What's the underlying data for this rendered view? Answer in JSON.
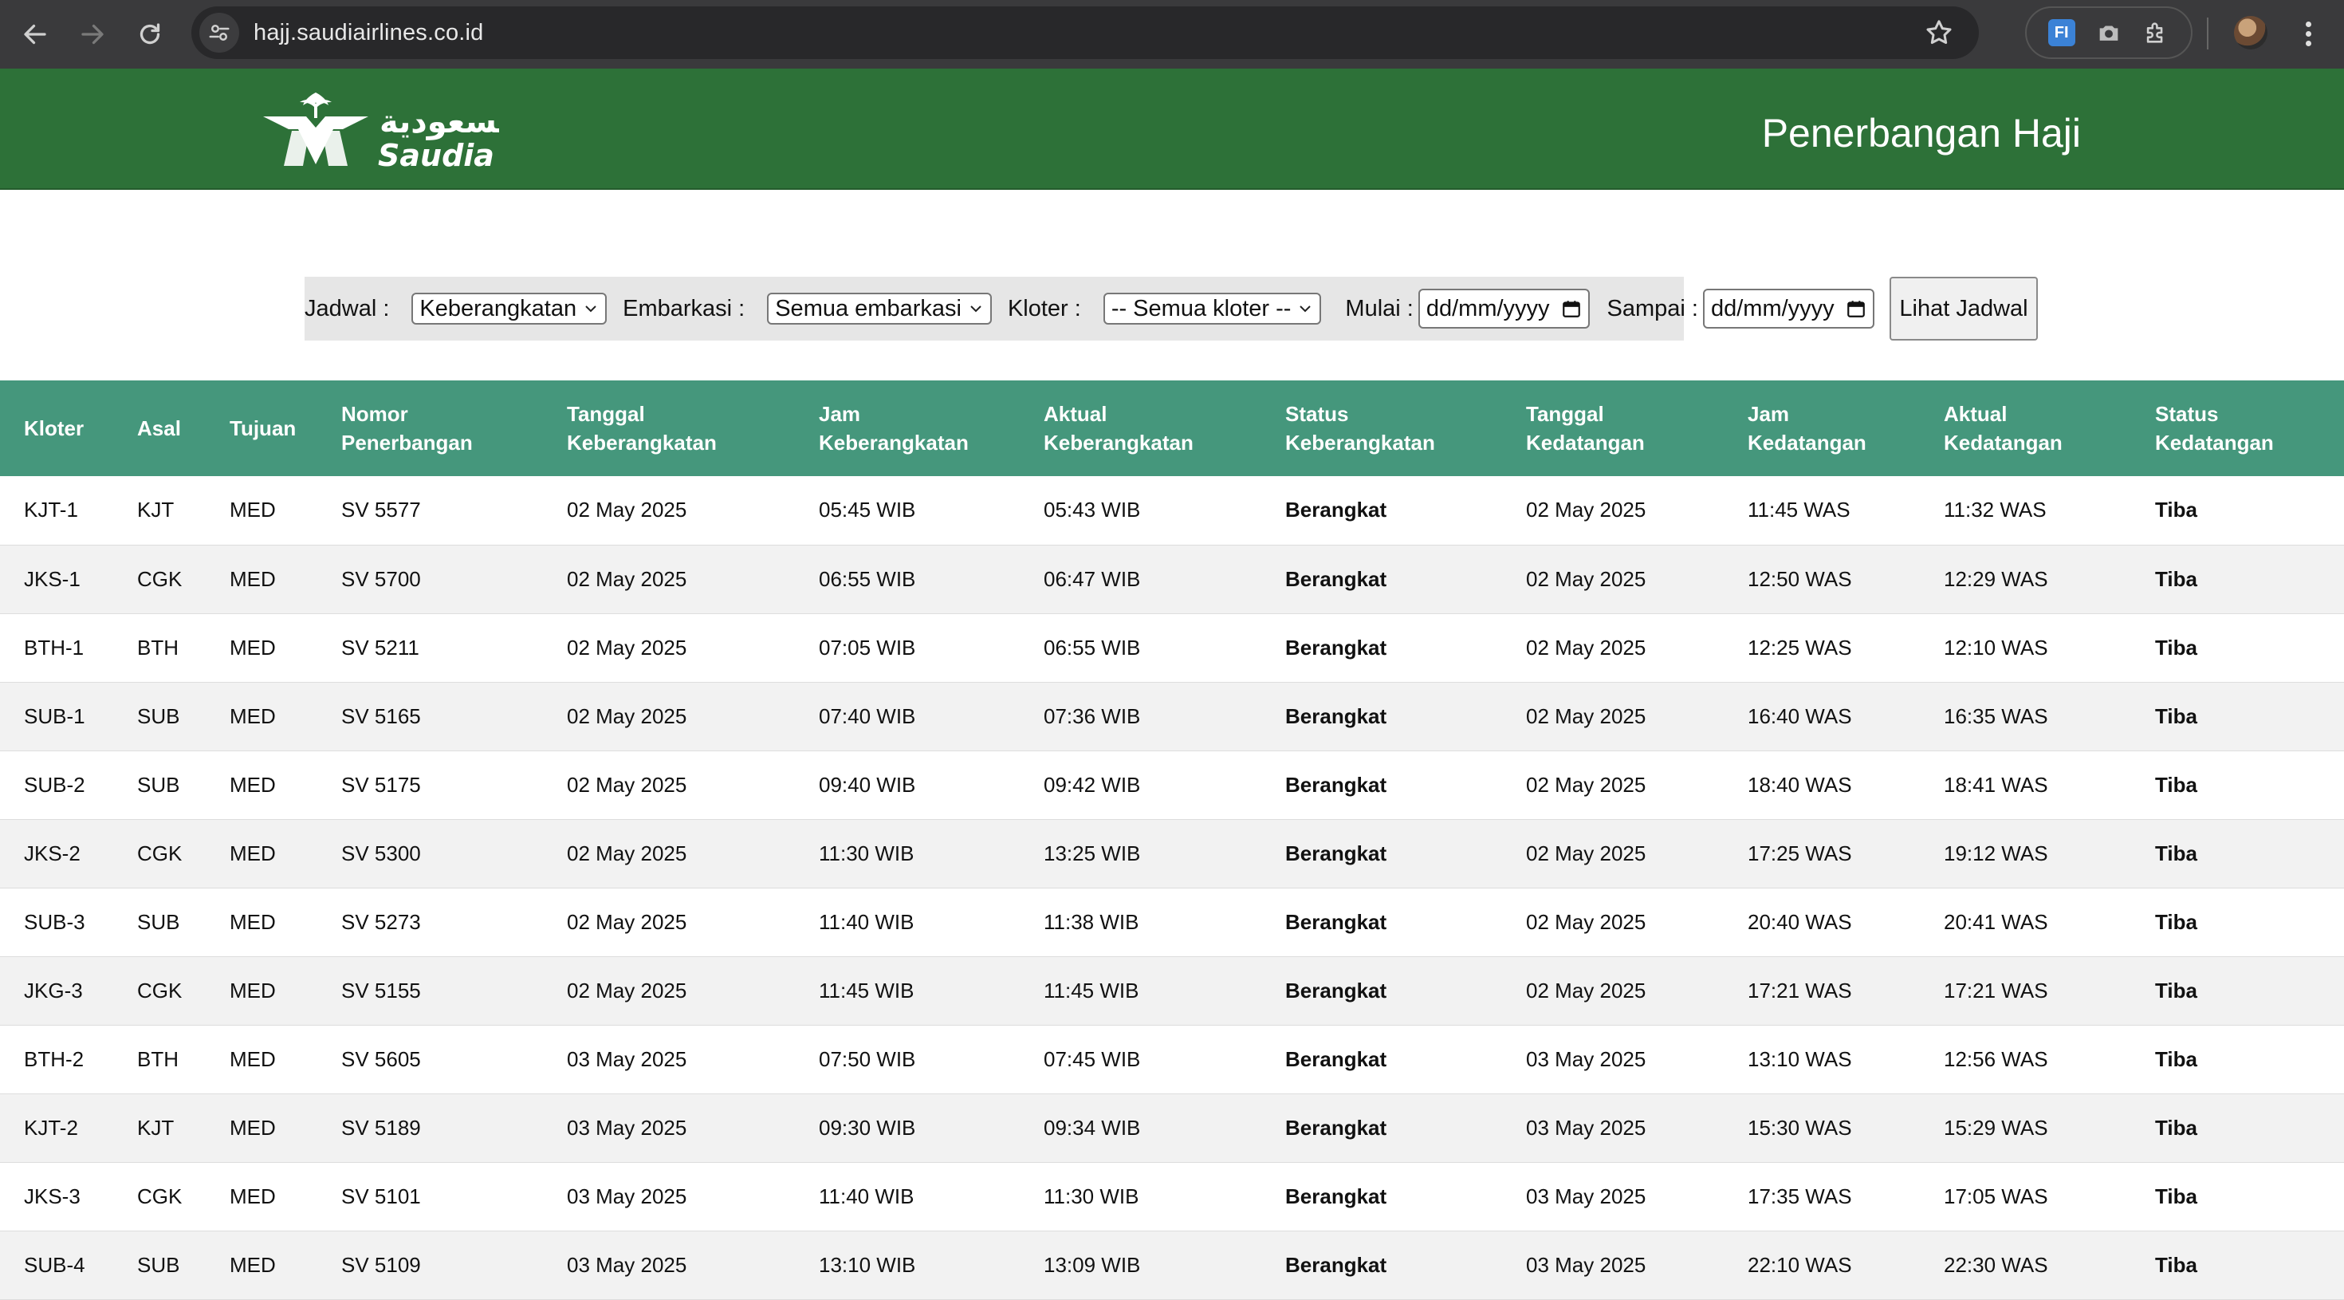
{
  "browser": {
    "url": "hajj.saudiairlines.co.id",
    "extension_label": "FI"
  },
  "header": {
    "brand_arabic": "السعودية",
    "brand_latin": "Saudia",
    "title": "Penerbangan Haji"
  },
  "filters": {
    "jadwal_label": "Jadwal :",
    "jadwal_value": "Keberangkatan",
    "embarkasi_label": "Embarkasi :",
    "embarkasi_value": "Semua embarkasi",
    "kloter_label": "Kloter :",
    "kloter_value": "-- Semua kloter --",
    "mulai_label": "Mulai :",
    "mulai_placeholder": "dd/mm/yyyy",
    "sampai_label": "Sampai :",
    "sampai_placeholder": "dd/mm/yyyy",
    "button_label": "Lihat Jadwal"
  },
  "table": {
    "headers": [
      [
        "Kloter",
        ""
      ],
      [
        "Asal",
        ""
      ],
      [
        "Tujuan",
        ""
      ],
      [
        "Nomor",
        "Penerbangan"
      ],
      [
        "Tanggal",
        "Keberangkatan"
      ],
      [
        "Jam",
        "Keberangkatan"
      ],
      [
        "Aktual",
        "Keberangkatan"
      ],
      [
        "Status",
        "Keberangkatan"
      ],
      [
        "Tanggal",
        "Kedatangan"
      ],
      [
        "Jam",
        "Kedatangan"
      ],
      [
        "Aktual",
        "Kedatangan"
      ],
      [
        "Status",
        "Kedatangan"
      ]
    ],
    "rows": [
      [
        "KJT-1",
        "KJT",
        "MED",
        "SV 5577",
        "02 May 2025",
        "05:45 WIB",
        "05:43 WIB",
        "Berangkat",
        "02 May 2025",
        "11:45 WAS",
        "11:32 WAS",
        "Tiba"
      ],
      [
        "JKS-1",
        "CGK",
        "MED",
        "SV 5700",
        "02 May 2025",
        "06:55 WIB",
        "06:47 WIB",
        "Berangkat",
        "02 May 2025",
        "12:50 WAS",
        "12:29 WAS",
        "Tiba"
      ],
      [
        "BTH-1",
        "BTH",
        "MED",
        "SV 5211",
        "02 May 2025",
        "07:05 WIB",
        "06:55 WIB",
        "Berangkat",
        "02 May 2025",
        "12:25 WAS",
        "12:10 WAS",
        "Tiba"
      ],
      [
        "SUB-1",
        "SUB",
        "MED",
        "SV 5165",
        "02 May 2025",
        "07:40 WIB",
        "07:36 WIB",
        "Berangkat",
        "02 May 2025",
        "16:40 WAS",
        "16:35 WAS",
        "Tiba"
      ],
      [
        "SUB-2",
        "SUB",
        "MED",
        "SV 5175",
        "02 May 2025",
        "09:40 WIB",
        "09:42 WIB",
        "Berangkat",
        "02 May 2025",
        "18:40 WAS",
        "18:41 WAS",
        "Tiba"
      ],
      [
        "JKS-2",
        "CGK",
        "MED",
        "SV 5300",
        "02 May 2025",
        "11:30 WIB",
        "13:25 WIB",
        "Berangkat",
        "02 May 2025",
        "17:25 WAS",
        "19:12 WAS",
        "Tiba"
      ],
      [
        "SUB-3",
        "SUB",
        "MED",
        "SV 5273",
        "02 May 2025",
        "11:40 WIB",
        "11:38 WIB",
        "Berangkat",
        "02 May 2025",
        "20:40 WAS",
        "20:41 WAS",
        "Tiba"
      ],
      [
        "JKG-3",
        "CGK",
        "MED",
        "SV 5155",
        "02 May 2025",
        "11:45 WIB",
        "11:45 WIB",
        "Berangkat",
        "02 May 2025",
        "17:21 WAS",
        "17:21 WAS",
        "Tiba"
      ],
      [
        "BTH-2",
        "BTH",
        "MED",
        "SV 5605",
        "03 May 2025",
        "07:50 WIB",
        "07:45 WIB",
        "Berangkat",
        "03 May 2025",
        "13:10 WAS",
        "12:56 WAS",
        "Tiba"
      ],
      [
        "KJT-2",
        "KJT",
        "MED",
        "SV 5189",
        "03 May 2025",
        "09:30 WIB",
        "09:34 WIB",
        "Berangkat",
        "03 May 2025",
        "15:30 WAS",
        "15:29 WAS",
        "Tiba"
      ],
      [
        "JKS-3",
        "CGK",
        "MED",
        "SV 5101",
        "03 May 2025",
        "11:40 WIB",
        "11:30 WIB",
        "Berangkat",
        "03 May 2025",
        "17:35 WAS",
        "17:05 WAS",
        "Tiba"
      ],
      [
        "SUB-4",
        "SUB",
        "MED",
        "SV 5109",
        "03 May 2025",
        "13:10 WIB",
        "13:09 WIB",
        "Berangkat",
        "03 May 2025",
        "22:10 WAS",
        "22:30 WAS",
        "Tiba"
      ]
    ]
  },
  "colors": {
    "header_green": "#2d7138",
    "table_header_green": "#45977c"
  }
}
